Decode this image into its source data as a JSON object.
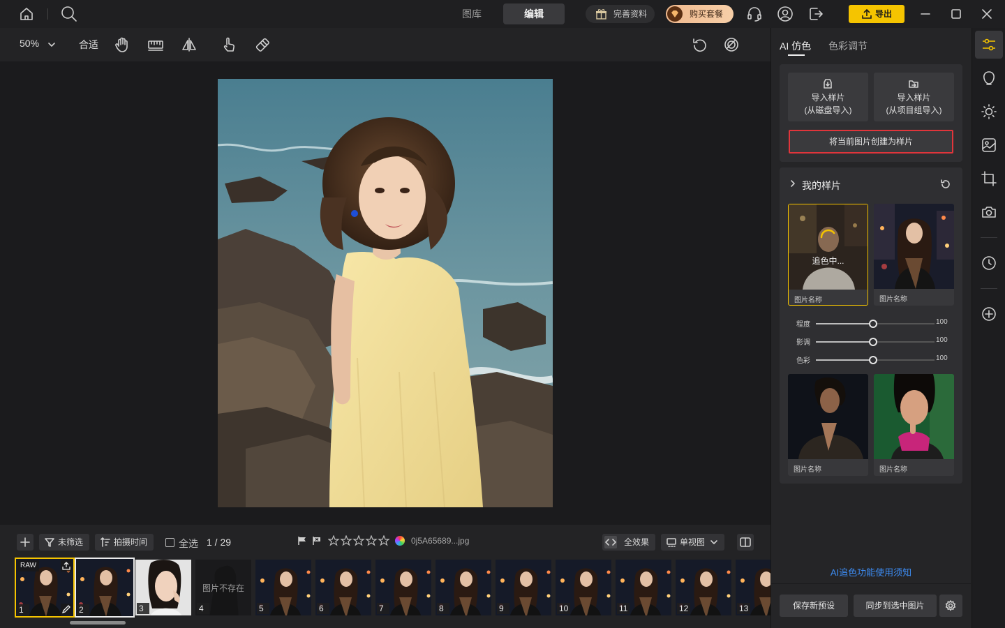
{
  "titlebar": {
    "tabs": [
      {
        "label": "图库",
        "active": false
      },
      {
        "label": "编辑",
        "active": true
      }
    ],
    "complete_profile": "完善资料",
    "buy_plan": "购买套餐",
    "export_label": "导出",
    "accent": "#f5c400"
  },
  "toolbar": {
    "zoom": "50%",
    "fit": "合适"
  },
  "filmstrip_bar": {
    "filter": "未筛选",
    "sort": "拍摄时间",
    "select_all": "全选",
    "position": "1 / 29",
    "rating_stars": 0,
    "filename": "0j5A65689...jpg",
    "full_effect": "全效果",
    "view_mode": "单视图"
  },
  "filmstrip": {
    "thumbs": [
      {
        "num": "1",
        "badge": "RAW",
        "state": "selected"
      },
      {
        "num": "2",
        "state": "active"
      },
      {
        "num": "3",
        "kind": "portrait"
      },
      {
        "num": "4",
        "missing": "图片不存在"
      },
      {
        "num": "5"
      },
      {
        "num": "6"
      },
      {
        "num": "7"
      },
      {
        "num": "8"
      },
      {
        "num": "9"
      },
      {
        "num": "10"
      },
      {
        "num": "11"
      },
      {
        "num": "12"
      },
      {
        "num": "13"
      }
    ]
  },
  "right_panel": {
    "tabs": [
      {
        "label": "AI 仿色",
        "active": true
      },
      {
        "label": "色彩调节",
        "active": false
      }
    ],
    "import_disk": {
      "line1": "导入样片",
      "line2": "(从磁盘导入)"
    },
    "import_project": {
      "line1": "导入样片",
      "line2": "(从项目组导入)"
    },
    "create_sample": "将当前图片创建为样片",
    "my_samples": "我的样片",
    "samples": [
      {
        "caption": "图片名称",
        "status": "追色中...",
        "selected": true
      },
      {
        "caption": "图片名称"
      },
      {
        "caption": "图片名称"
      },
      {
        "caption": "图片名称"
      }
    ],
    "sliders": [
      {
        "label": "程度",
        "value": "100",
        "fraction": 0.48
      },
      {
        "label": "影调",
        "value": "100",
        "fraction": 0.48
      },
      {
        "label": "色彩",
        "value": "100",
        "fraction": 0.48
      }
    ],
    "notice_link": "AI追色功能使用须知",
    "link_color": "#3d8df5",
    "save_preset": "保存新预设",
    "sync_selected": "同步到选中图片"
  }
}
